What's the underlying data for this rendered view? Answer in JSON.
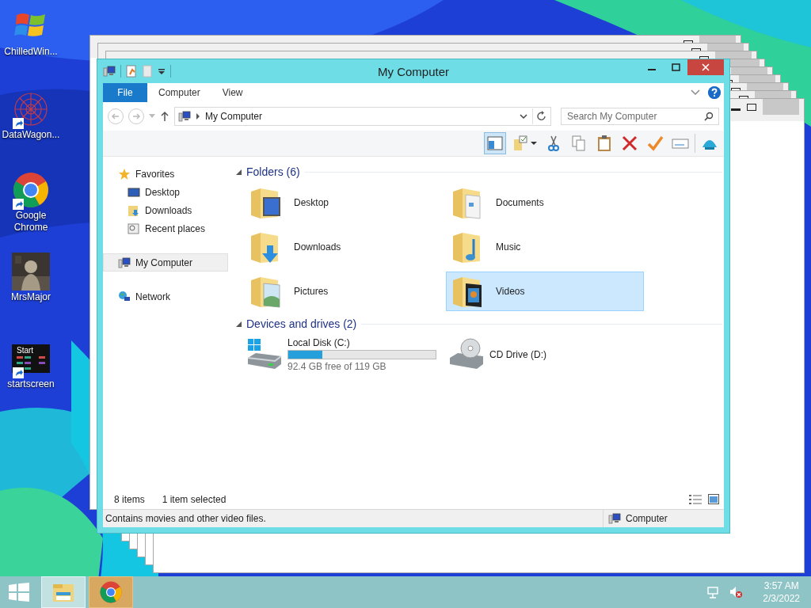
{
  "desktop_icons": [
    {
      "label": "ChilledWin...",
      "kind": "windows",
      "shortcut": false
    },
    {
      "label": "DataWagon...",
      "kind": "mandala",
      "shortcut": true
    },
    {
      "label": "Google Chrome",
      "kind": "chrome",
      "shortcut": true
    },
    {
      "label": "MrsMajor",
      "kind": "picture",
      "shortcut": false
    },
    {
      "label": "startscreen",
      "kind": "tiles",
      "tile_text": "Start",
      "shortcut": true
    }
  ],
  "window": {
    "title": "My Computer",
    "ribbon_tabs": [
      {
        "label": "File",
        "kind": "file"
      },
      {
        "label": "Computer",
        "kind": "tab"
      },
      {
        "label": "View",
        "kind": "tab"
      }
    ],
    "address": "My Computer",
    "search": {
      "placeholder": "Search My Computer"
    },
    "toolbar": [
      {
        "kind": "pane",
        "selected": true
      },
      {
        "kind": "properties",
        "selected": false
      },
      {
        "kind": "cut",
        "selected": false
      },
      {
        "kind": "copy",
        "selected": false
      },
      {
        "kind": "paste",
        "selected": false
      },
      {
        "kind": "delete",
        "selected": false
      },
      {
        "kind": "check",
        "selected": false
      },
      {
        "kind": "rename",
        "selected": false
      },
      {
        "kind": "shell",
        "selected": false
      }
    ],
    "nav": [
      {
        "label": "Favorites",
        "kind": "star",
        "selected": false,
        "children": [
          {
            "label": "Desktop",
            "kind": "desktop",
            "selected": false
          },
          {
            "label": "Downloads",
            "kind": "downloads",
            "selected": false
          },
          {
            "label": "Recent places",
            "kind": "recent",
            "selected": false
          }
        ]
      },
      {
        "label": "My Computer",
        "kind": "computer",
        "selected": true
      },
      {
        "label": "Network",
        "kind": "network",
        "selected": false
      }
    ],
    "groups": [
      {
        "title": "Folders (6)",
        "items": [
          {
            "name": "Desktop",
            "kind": "desktop",
            "selected": false
          },
          {
            "name": "Documents",
            "kind": "documents",
            "selected": false
          },
          {
            "name": "Downloads",
            "kind": "downloads",
            "selected": false
          },
          {
            "name": "Music",
            "kind": "music",
            "selected": false
          },
          {
            "name": "Pictures",
            "kind": "pictures",
            "selected": false
          },
          {
            "name": "Videos",
            "kind": "videos",
            "selected": true
          }
        ]
      },
      {
        "title": "Devices and drives (2)",
        "items": [
          {
            "name": "Local Disk (C:)",
            "kind": "disk",
            "level": 0.23,
            "detail": "92.4 GB free of 119 GB",
            "selected": false
          },
          {
            "name": "CD Drive (D:)",
            "kind": "cd",
            "selected": false
          }
        ]
      }
    ],
    "status": {
      "count": "8 items",
      "selection": "1 item selected"
    },
    "details_bar": {
      "description": "Contains movies and other video files.",
      "location": "Computer"
    }
  },
  "taskbar": {
    "buttons": [
      {
        "kind": "start"
      },
      {
        "kind": "explorer",
        "selected": true
      },
      {
        "kind": "chrome",
        "selected": false
      }
    ],
    "time": "3:57 AM",
    "date": "2/3/2022"
  }
}
